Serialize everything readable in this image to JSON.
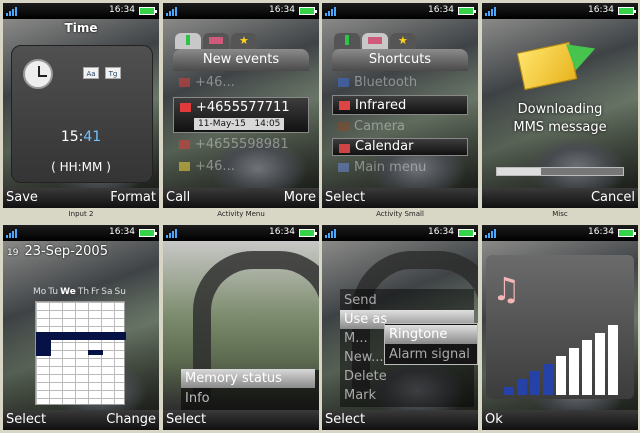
{
  "status": {
    "time": "16:34"
  },
  "captions": {
    "s1": "Input 2",
    "s2": "Activity Menu",
    "s3": "Activity Small",
    "s4": "Misc"
  },
  "s1": {
    "title": "Time",
    "chip1": "Aa",
    "chip2": "Tg",
    "hour": "15:",
    "minute": "41",
    "format": "( HH:MM )",
    "left": "Save",
    "right": "Format"
  },
  "s2": {
    "header": "New events",
    "rows": [
      "+46...",
      "+4655577711",
      "11-May-15",
      "14:05",
      "+4655598981",
      "+46..."
    ],
    "left": "Call",
    "right": "More"
  },
  "s3": {
    "header": "Shortcuts",
    "rows": [
      "Bluetooth",
      "Infrared",
      "Camera",
      "Calendar",
      "Main menu"
    ],
    "left": "Select"
  },
  "s4": {
    "line1": "Downloading",
    "line2": "MMS message",
    "progress": 0.35,
    "right": "Cancel"
  },
  "s5": {
    "week": "19",
    "date": "23-Sep-2005",
    "days": [
      "Mo",
      "Tu",
      "We",
      "Th",
      "Fr",
      "Sa",
      "Su"
    ],
    "left": "Select",
    "right": "Change"
  },
  "s6": {
    "opt1": "Memory status",
    "opt2": "Info",
    "left": "Select"
  },
  "s7": {
    "items": [
      "Send",
      "Use as",
      "M...",
      "New...",
      "Delete",
      "Mark"
    ],
    "sub": [
      "Ringtone",
      "Alarm signal"
    ],
    "left": "Select"
  },
  "s8": {
    "left": "Ok",
    "bars": 9,
    "level": 0.45
  }
}
